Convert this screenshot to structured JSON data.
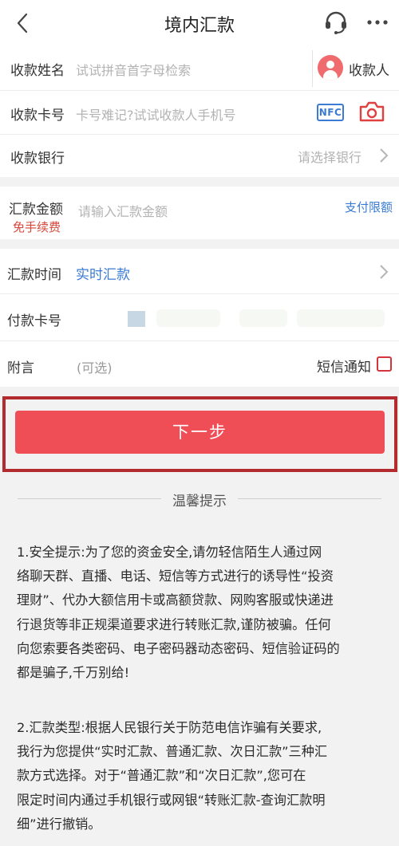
{
  "header": {
    "title": "境内汇款",
    "back_icon": "chevron-left-icon",
    "service_icon": "headset-icon",
    "more_icon": "more-horizontal-icon"
  },
  "form": {
    "payee_name": {
      "label": "收款姓名",
      "placeholder": "试试拼音首字母检索",
      "payee_button": "收款人"
    },
    "card_number": {
      "label": "收款卡号",
      "placeholder": "卡号难记?试试收款人手机号",
      "nfc": "NFC"
    },
    "bank": {
      "label": "收款银行",
      "placeholder": "请选择银行"
    },
    "amount": {
      "label": "汇款金额",
      "placeholder": "请输入汇款金额",
      "fee_note": "免手续费",
      "limit_link": "支付限额"
    },
    "time": {
      "label": "汇款时间",
      "value": "实时汇款"
    },
    "pay_card": {
      "label": "付款卡号"
    },
    "note": {
      "label": "附言",
      "placeholder": "(可选)",
      "sms_label": "短信通知"
    }
  },
  "next_button": "下一步",
  "tips": {
    "title": "温馨提示",
    "paragraphs": [
      [
        "1.安全提示:为了您的资金安全,请勿轻信陌生人通过网",
        "络聊天群、直播、电话、短信等方式进行的诱导性“投资",
        "理财”、代办大额信用卡或高额贷款、网购客服或快递进",
        "行退货等非正规渠道要求进行转账汇款,谨防被骗。任何",
        "向您索要各类密码、电子密码器动态密码、短信验证码的",
        "都是骗子,千万别给!"
      ],
      [
        "2.汇款类型:根据人民银行关于防范电信诈骗有关要求,",
        "我行为您提供“实时汇款、普通汇款、次日汇款”三种汇",
        "款方式选择。对于“普通汇款”和“次日汇款”,您可在",
        "限定时间内通过手机银行或网银“转账汇款-查询汇款明",
        "细”进行撤销。"
      ]
    ]
  },
  "colors": {
    "accent_blue": "#3b7bd4",
    "primary_red": "#f04e57",
    "highlight_border": "#b32b2f",
    "fee_red": "#d6473a"
  }
}
